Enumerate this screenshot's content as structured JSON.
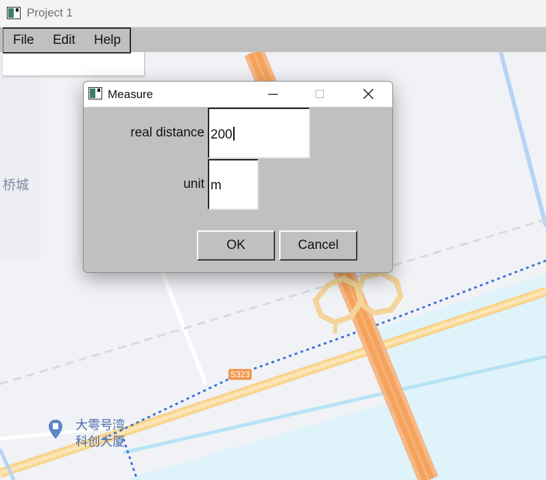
{
  "window": {
    "title": "Project 1"
  },
  "menubar": {
    "items": [
      {
        "label": "File"
      },
      {
        "label": "Edit"
      },
      {
        "label": "Help"
      }
    ]
  },
  "map": {
    "labels": [
      {
        "text": "桥城"
      },
      {
        "text": "大雩号湾"
      },
      {
        "text": "科创大厦"
      }
    ],
    "road_badge": "S323",
    "colors": {
      "land": "#f0f2f6",
      "water": "#dff3fb",
      "highway": "#f5a35c",
      "road_yellow": "#f7d58c",
      "dotted_boundary": "#3a6fd8"
    }
  },
  "dialog": {
    "title": "Measure",
    "fields": {
      "distance": {
        "label": "real distance",
        "value": "200"
      },
      "unit": {
        "label": "unit",
        "value": "m"
      }
    },
    "buttons": {
      "ok": "OK",
      "cancel": "Cancel"
    }
  }
}
